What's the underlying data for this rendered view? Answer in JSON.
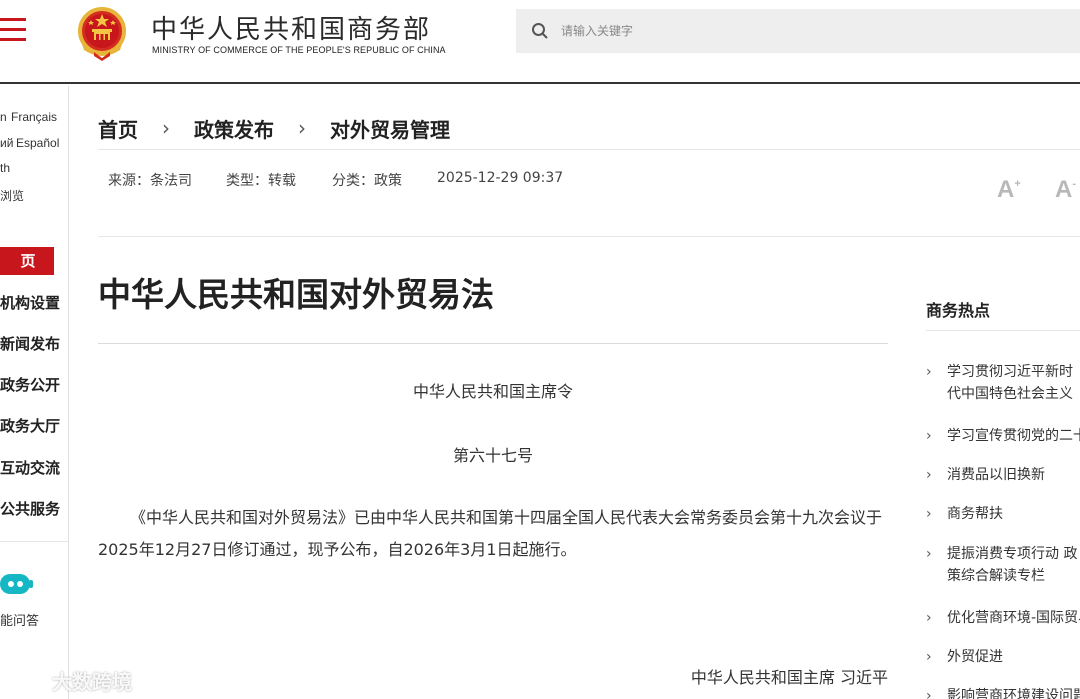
{
  "header": {
    "site_title_cn": "中华人民共和国商务部",
    "site_title_en": "MINISTRY OF COMMERCE OF THE PEOPLE'S REPUBLIC OF CHINA",
    "search_placeholder": "请输入关键字",
    "accent_color": "#c8161d"
  },
  "sidebar": {
    "languages": [
      "n",
      "Français",
      "ий",
      "Español",
      "th",
      "浏览"
    ],
    "home_label": "页",
    "nav_items": [
      "机构设置",
      "新闻发布",
      "政务公开",
      "政务大厅",
      "互动交流",
      "公共服务"
    ],
    "assistant_label": "能问答"
  },
  "breadcrumb": {
    "home": "首页",
    "level1": "政策发布",
    "level2": "对外贸易管理",
    "separator": "›"
  },
  "meta": {
    "source": "来源：条法司",
    "type": "类型：转载",
    "category": "分类：政策",
    "datetime": "2025-12-29 09:37",
    "font_larger": "A",
    "font_smaller": "A"
  },
  "article": {
    "title": "中华人民共和国对外贸易法",
    "order_issuer": "中华人民共和国主席令",
    "order_number": "第六十七号",
    "body": "《中华人民共和国对外贸易法》已由中华人民共和国第十四届全国人民代表大会常务委员会第十九次会议于2025年12月27日修订通过，现予公布，自2026年3月1日起施行。",
    "signature": "中华人民共和国主席 习近平"
  },
  "hot": {
    "title": "商务热点",
    "items": [
      "学习贯彻习近平新时代中国特色社会主义思想主题教育",
      "学习宣传贯彻党的二十大精神",
      "消费品以旧换新",
      "商务帮扶",
      "提振消费专项行动 政策综合解读专栏",
      "优化营商环境-国际贸易",
      "外贸促进",
      "影响营商环境建设问题"
    ]
  },
  "watermark": {
    "text": "大数跨境"
  }
}
